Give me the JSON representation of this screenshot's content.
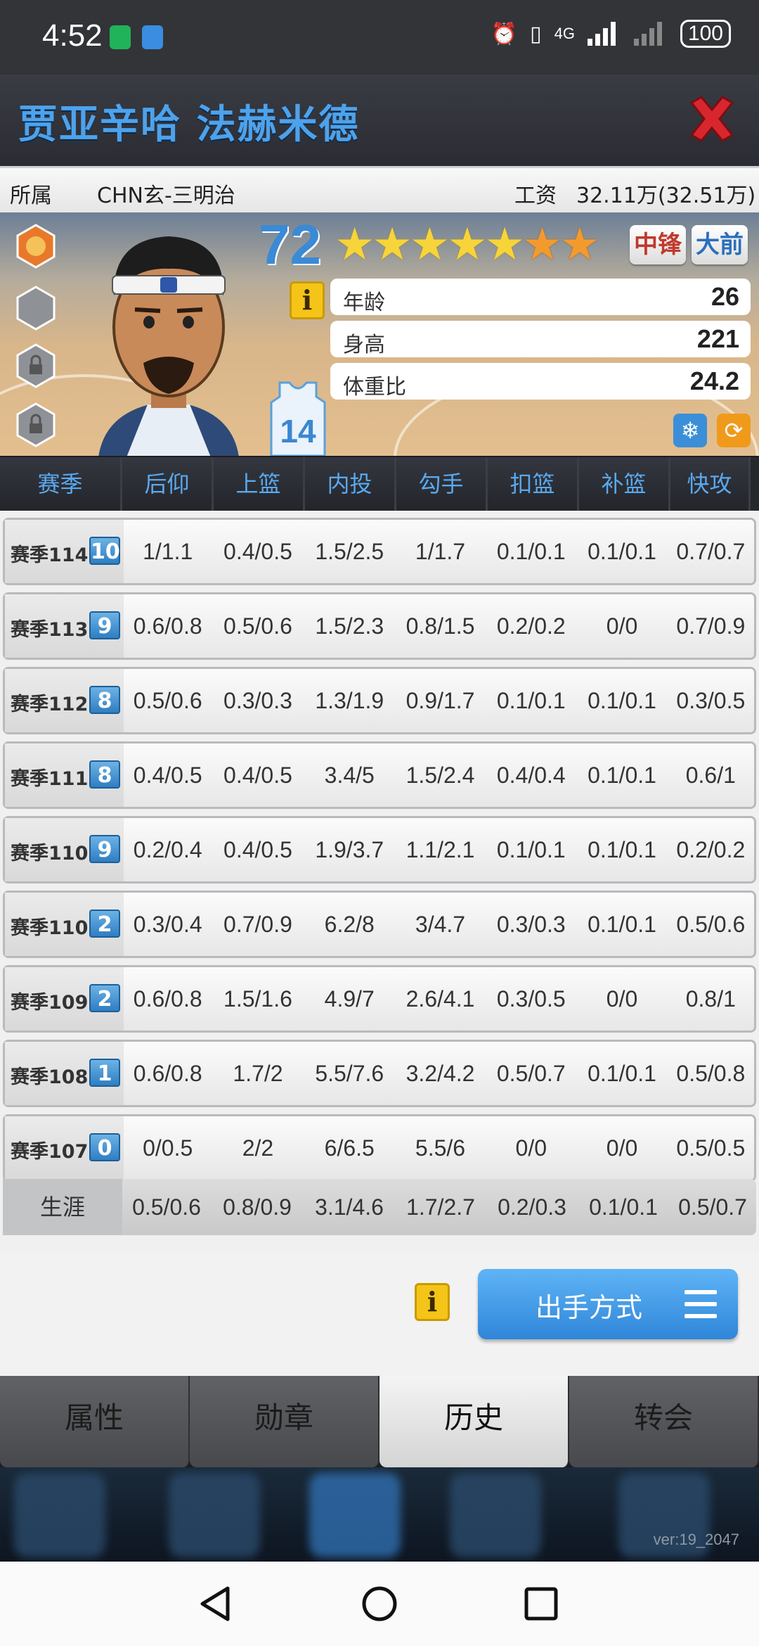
{
  "status": {
    "time": "4:52",
    "network": "4G",
    "battery": "100"
  },
  "header": {
    "player_name": "贾亚辛哈 法赫米德"
  },
  "info": {
    "team_label": "所属",
    "team_value": "CHN玄-三明治",
    "salary_label": "工资",
    "salary_value": "32.11万(32.51万)"
  },
  "card": {
    "rating": "72",
    "stars_gold": 5,
    "stars_orange": 2,
    "positions": [
      {
        "label": "中锋",
        "color": "#c0392b"
      },
      {
        "label": "大前",
        "color": "#2c6fbd"
      }
    ],
    "jersey_number": "14",
    "attributes": [
      {
        "label": "年龄",
        "value": "26"
      },
      {
        "label": "身高",
        "value": "221"
      },
      {
        "label": "体重比",
        "value": "24.2"
      }
    ]
  },
  "table": {
    "headers": [
      "赛季",
      "后仰",
      "上篮",
      "内投",
      "勾手",
      "扣篮",
      "补篮",
      "快攻"
    ],
    "rows": [
      {
        "season": "赛季114",
        "badge": "10",
        "cells": [
          "1/1.1",
          "0.4/0.5",
          "1.5/2.5",
          "1/1.7",
          "0.1/0.1",
          "0.1/0.1",
          "0.7/0.7"
        ]
      },
      {
        "season": "赛季113",
        "badge": "9",
        "cells": [
          "0.6/0.8",
          "0.5/0.6",
          "1.5/2.3",
          "0.8/1.5",
          "0.2/0.2",
          "0/0",
          "0.7/0.9"
        ]
      },
      {
        "season": "赛季112",
        "badge": "8",
        "cells": [
          "0.5/0.6",
          "0.3/0.3",
          "1.3/1.9",
          "0.9/1.7",
          "0.1/0.1",
          "0.1/0.1",
          "0.3/0.5"
        ]
      },
      {
        "season": "赛季111",
        "badge": "8",
        "cells": [
          "0.4/0.5",
          "0.4/0.5",
          "3.4/5",
          "1.5/2.4",
          "0.4/0.4",
          "0.1/0.1",
          "0.6/1"
        ]
      },
      {
        "season": "赛季110",
        "badge": "9",
        "cells": [
          "0.2/0.4",
          "0.4/0.5",
          "1.9/3.7",
          "1.1/2.1",
          "0.1/0.1",
          "0.1/0.1",
          "0.2/0.2"
        ]
      },
      {
        "season": "赛季110",
        "badge": "2",
        "cells": [
          "0.3/0.4",
          "0.7/0.9",
          "6.2/8",
          "3/4.7",
          "0.3/0.3",
          "0.1/0.1",
          "0.5/0.6"
        ]
      },
      {
        "season": "赛季109",
        "badge": "2",
        "cells": [
          "0.6/0.8",
          "1.5/1.6",
          "4.9/7",
          "2.6/4.1",
          "0.3/0.5",
          "0/0",
          "0.8/1"
        ]
      },
      {
        "season": "赛季108",
        "badge": "1",
        "cells": [
          "0.6/0.8",
          "1.7/2",
          "5.5/7.6",
          "3.2/4.2",
          "0.5/0.7",
          "0.1/0.1",
          "0.5/0.8"
        ]
      },
      {
        "season": "赛季107",
        "badge": "0",
        "cells": [
          "0/0.5",
          "2/2",
          "6/6.5",
          "5.5/6",
          "0/0",
          "0/0",
          "0.5/0.5"
        ]
      }
    ],
    "career": {
      "label": "生涯",
      "cells": [
        "0.5/0.6",
        "0.8/0.9",
        "3.1/4.6",
        "1.7/2.7",
        "0.2/0.3",
        "0.1/0.1",
        "0.5/0.7"
      ]
    }
  },
  "actions": {
    "shoot_button": "出手方式"
  },
  "tabs": [
    {
      "label": "属性",
      "active": false
    },
    {
      "label": "勋章",
      "active": false
    },
    {
      "label": "历史",
      "active": true
    },
    {
      "label": "转会",
      "active": false
    }
  ],
  "footer": {
    "version": "ver:19_2047"
  }
}
